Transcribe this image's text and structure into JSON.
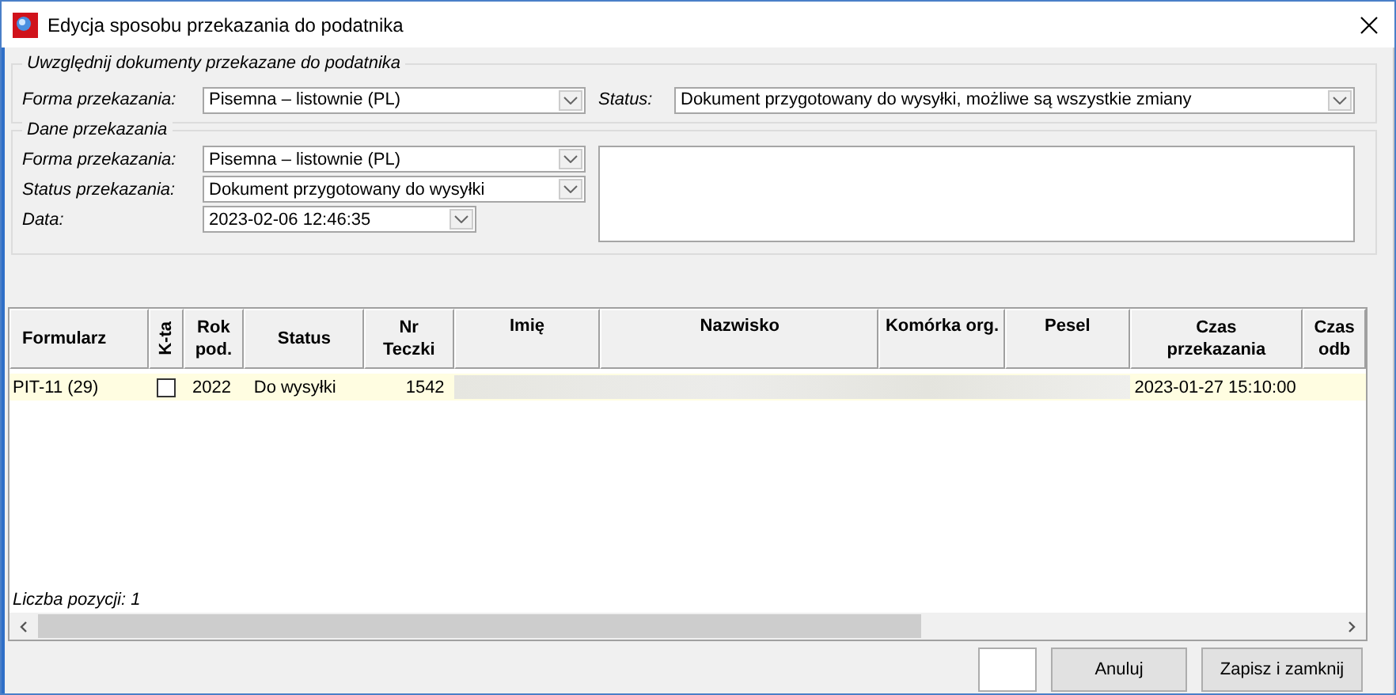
{
  "window": {
    "title": "Edycja sposobu przekazania do podatnika"
  },
  "filter_group": {
    "legend": "Uwzględnij dokumenty przekazane do podatnika",
    "fields": [
      {
        "label": "Forma przekazania:",
        "value": "Pisemna – listownie (PL)"
      },
      {
        "label": "Status:",
        "value": "Dokument przygotowany do wysyłki, możliwe są wszystkie zmiany"
      }
    ]
  },
  "transfer_group": {
    "legend": "Dane przekazania",
    "fields": [
      {
        "label": "Forma przekazania:",
        "value": "Pisemna – listownie (PL)",
        "kind": "dropdown"
      },
      {
        "label": "Status przekazania:",
        "value": "Dokument przygotowany do wysyłki",
        "kind": "dropdown"
      },
      {
        "label": "Data:",
        "value": "2023-02-06 12:46:35",
        "kind": "date"
      }
    ]
  },
  "table": {
    "columns": [
      "Formularz",
      "K-ta",
      "Rok pod.",
      "Status",
      "Nr Teczki",
      "Imię",
      "Nazwisko",
      "Komórka org.",
      "Pesel",
      "Czas przekazania",
      "Czas odb"
    ],
    "rows": [
      {
        "formularz": "PIT-11 (29)",
        "checked": false,
        "rok": "2022",
        "status": "Do wysyłki",
        "nr_teczki": "1542",
        "czas_przekazania": "2023-01-27 15:10:00",
        "selected": true
      }
    ]
  },
  "status_text": "Liczba pozycji: 1",
  "buttons": [
    "Anuluj",
    "Zapisz i zamknij"
  ]
}
